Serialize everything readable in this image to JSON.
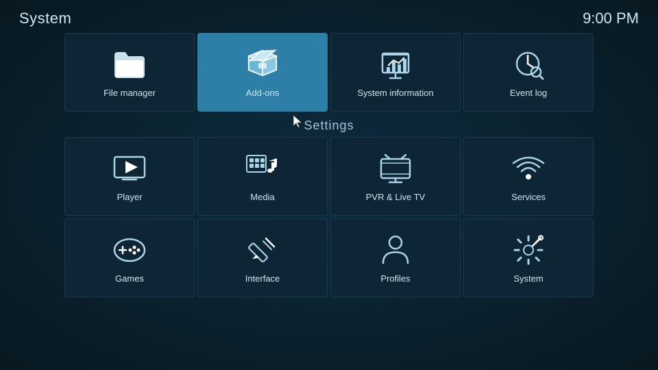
{
  "header": {
    "title": "System",
    "time": "9:00 PM"
  },
  "top_tiles": [
    {
      "id": "file-manager",
      "label": "File manager",
      "active": false
    },
    {
      "id": "add-ons",
      "label": "Add-ons",
      "active": true
    },
    {
      "id": "system-information",
      "label": "System information",
      "active": false
    },
    {
      "id": "event-log",
      "label": "Event log",
      "active": false
    }
  ],
  "settings_label": "Settings",
  "settings_row1": [
    {
      "id": "player",
      "label": "Player"
    },
    {
      "id": "media",
      "label": "Media"
    },
    {
      "id": "pvr-live-tv",
      "label": "PVR & Live TV"
    },
    {
      "id": "services",
      "label": "Services"
    }
  ],
  "settings_row2": [
    {
      "id": "games",
      "label": "Games"
    },
    {
      "id": "interface",
      "label": "Interface"
    },
    {
      "id": "profiles",
      "label": "Profiles"
    },
    {
      "id": "system",
      "label": "System"
    }
  ]
}
